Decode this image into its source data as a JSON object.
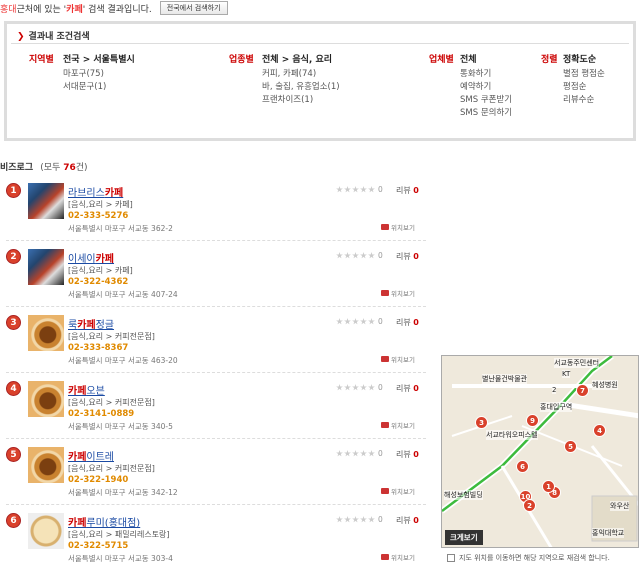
{
  "topbar": {
    "location": "홍대",
    "prefix_text": "근처에 있는 '",
    "keyword": "카페",
    "suffix_text": "' 검색 결과입니다.",
    "nationwide_button": "전국에서 검색하기"
  },
  "filter": {
    "title": "결과내 조건검색",
    "region": {
      "label": "지역별",
      "current": "전국 > 서울특별시",
      "options": [
        "마포구(75)",
        "서대문구(1)"
      ]
    },
    "industry": {
      "label": "업종별",
      "current": "전체 > 음식, 요리",
      "options": [
        "커피, 카페(74)",
        "바, 술집, 유흥업소(1)",
        "프랜차이즈(1)"
      ]
    },
    "business": {
      "label": "업체별",
      "current": "전체",
      "options": [
        "통화하기",
        "예약하기",
        "SMS 쿠폰받기",
        "SMS 문의하기"
      ]
    },
    "sort": {
      "label": "정렬",
      "current": "정확도순",
      "options": [
        "별점 평점순",
        "평점순",
        "리뷰수순"
      ]
    }
  },
  "section": {
    "title": "비즈로그",
    "count_prefix": "(모두 ",
    "count": "76",
    "count_suffix": "건)"
  },
  "results": [
    {
      "rank": "1",
      "name_pre": "라브리스",
      "name_hl": "카페",
      "name_post": "",
      "category": "[음식,요리 > 카페]",
      "phone": "02-333-5276",
      "address": "서울특별시 마포구 서교동 362-2",
      "score": "0",
      "review_label": "리뷰",
      "reviews": "0",
      "map_link": "위치보기",
      "thumb": "cafe"
    },
    {
      "rank": "2",
      "name_pre": "이세이",
      "name_hl": "카페",
      "name_post": "",
      "category": "[음식,요리 > 카페]",
      "phone": "02-322-4362",
      "address": "서울특별시 마포구 서교동 407-24",
      "score": "0",
      "review_label": "리뷰",
      "reviews": "0",
      "map_link": "위치보기",
      "thumb": "cafe"
    },
    {
      "rank": "3",
      "name_pre": "룩",
      "name_hl": "카페",
      "name_post": "정글",
      "category": "[음식,요리 > 커피전문점]",
      "phone": "02-333-8367",
      "address": "서울특별시 마포구 서교동 463-20",
      "score": "0",
      "review_label": "리뷰",
      "reviews": "0",
      "map_link": "위치보기",
      "thumb": "coffee"
    },
    {
      "rank": "4",
      "name_pre": "",
      "name_hl": "카페",
      "name_post": "오븐",
      "category": "[음식,요리 > 커피전문점]",
      "phone": "02-3141-0889",
      "address": "서울특별시 마포구 서교동 340-5",
      "score": "0",
      "review_label": "리뷰",
      "reviews": "0",
      "map_link": "위치보기",
      "thumb": "coffee"
    },
    {
      "rank": "5",
      "name_pre": "",
      "name_hl": "카페",
      "name_post": "이트레",
      "category": "[음식,요리 > 커피전문점]",
      "phone": "02-322-1940",
      "address": "서울특별시 마포구 서교동 342-12",
      "score": "0",
      "review_label": "리뷰",
      "reviews": "0",
      "map_link": "위치보기",
      "thumb": "coffee"
    },
    {
      "rank": "6",
      "name_pre": "",
      "name_hl": "카페",
      "name_post": "루미(홍대점)",
      "category": "[음식,요리 > 패밀리레스토랑]",
      "phone": "02-322-5715",
      "address": "서울특별시 마포구 서교동 303-4",
      "score": "0",
      "review_label": "리뷰",
      "reviews": "0",
      "map_link": "위치보기",
      "thumb": "pizza"
    }
  ],
  "map": {
    "labels": [
      "서교동주민센터",
      "KT",
      "별난물건박물관",
      "2",
      "혜성병원",
      "홍대입구역",
      "서교타워오피스텔",
      "해성보험빌딩",
      "홍익대학교",
      "와우산"
    ],
    "pins": [
      "1",
      "2",
      "3",
      "4",
      "5",
      "6",
      "7",
      "8",
      "9",
      "10"
    ],
    "zoom_button": "크게보기",
    "footer_text": "지도 위치를 이동하면 해당 지역으로 재검색 합니다."
  },
  "colors": {
    "accent": "#cc0000",
    "phone": "#e08a00",
    "link": "#1a4aa3",
    "pin": "#d9412b"
  }
}
